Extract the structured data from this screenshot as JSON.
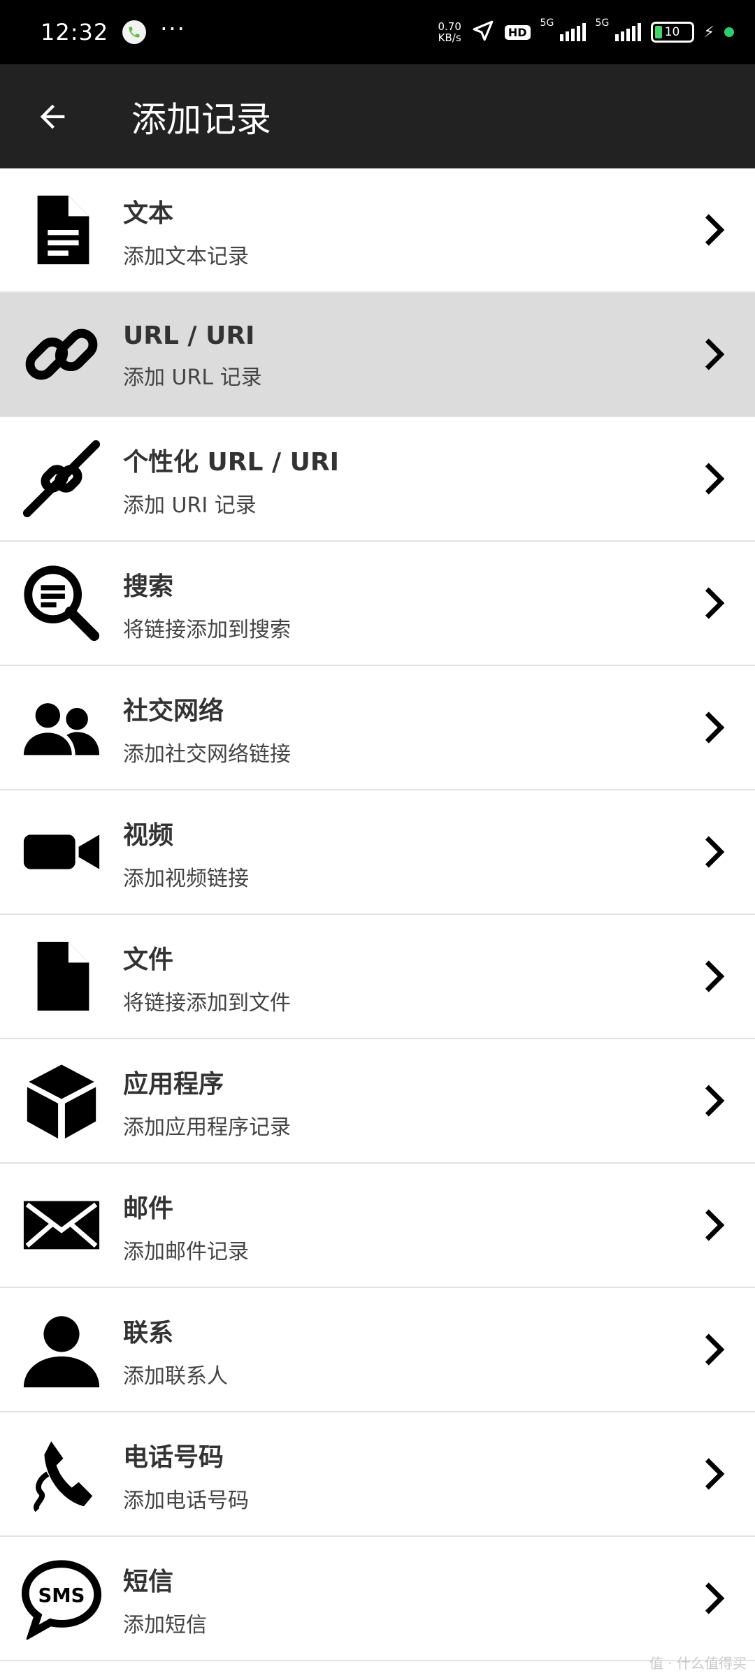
{
  "status_bar": {
    "time": "12:32",
    "more": "···",
    "net_speed_value": "0.70",
    "net_speed_unit": "KB/s",
    "hd": "HD",
    "signal1_label": "5G",
    "signal2_label": "5G",
    "battery_level": "10",
    "icons": [
      "call-icon",
      "location-arrow-icon",
      "charging-bolt-icon"
    ]
  },
  "app_bar": {
    "title": "添加记录",
    "back_icon": "arrow-left-icon"
  },
  "items": [
    {
      "title": "文本",
      "subtitle": "添加文本记录",
      "icon": "document-icon"
    },
    {
      "title": "URL / URI",
      "subtitle": "添加 URL 记录",
      "icon": "link-icon",
      "selected": true
    },
    {
      "title": "个性化 URL / URI",
      "subtitle": "添加 URI 记录",
      "icon": "custom-link-icon"
    },
    {
      "title": "搜索",
      "subtitle": "将链接添加到搜索",
      "icon": "search-icon"
    },
    {
      "title": "社交网络",
      "subtitle": "添加社交网络链接",
      "icon": "people-icon"
    },
    {
      "title": "视频",
      "subtitle": "添加视频链接",
      "icon": "video-camera-icon"
    },
    {
      "title": "文件",
      "subtitle": "将链接添加到文件",
      "icon": "file-icon"
    },
    {
      "title": "应用程序",
      "subtitle": "添加应用程序记录",
      "icon": "cube-icon"
    },
    {
      "title": "邮件",
      "subtitle": "添加邮件记录",
      "icon": "mail-icon"
    },
    {
      "title": "联系",
      "subtitle": "添加联系人",
      "icon": "person-icon"
    },
    {
      "title": "电话号码",
      "subtitle": "添加电话号码",
      "icon": "phone-icon"
    },
    {
      "title": "短信",
      "subtitle": "添加短信",
      "icon": "sms-icon"
    }
  ],
  "watermark": "值 · 什么值得买",
  "colors": {
    "status_bar_bg": "#000000",
    "app_bar_bg": "#222222",
    "selected_row_bg": "#dcdcdc",
    "divider": "#e2e2e2"
  }
}
